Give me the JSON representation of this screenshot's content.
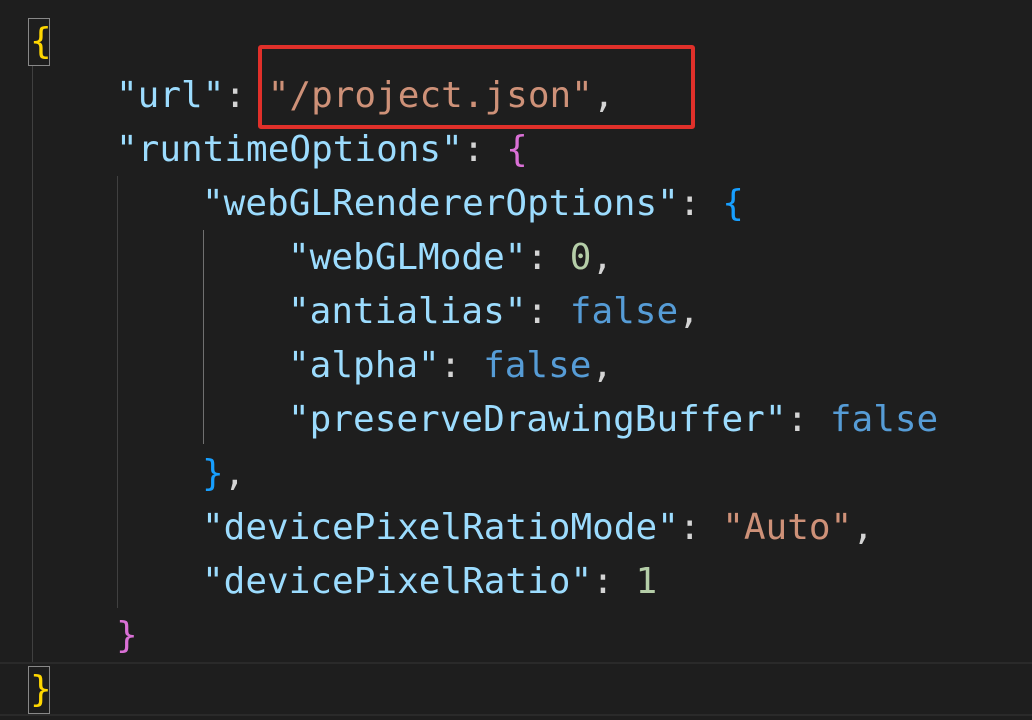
{
  "colors": {
    "background": "#1e1e1e",
    "string": "#ce9178",
    "key": "#9cdcfe",
    "number": "#b5cea8",
    "keyword": "#569cd6",
    "bracket_level1": "#ffd700",
    "bracket_level2": "#da70d6",
    "bracket_level3": "#179fff",
    "annotation_box": "#e0302a"
  },
  "code": {
    "open_root": "{",
    "url_key": "\"url\"",
    "url_value": "\"/project.json\"",
    "runtime_key": "\"runtimeOptions\"",
    "runtime_open": "{",
    "webgl_key": "\"webGLRendererOptions\"",
    "webgl_open": "{",
    "webglmode_key": "\"webGLMode\"",
    "webglmode_value": "0",
    "antialias_key": "\"antialias\"",
    "antialias_value": "false",
    "alpha_key": "\"alpha\"",
    "alpha_value": "false",
    "preserve_key": "\"preserveDrawingBuffer\"",
    "preserve_value": "false",
    "webgl_close": "}",
    "dprmode_key": "\"devicePixelRatioMode\"",
    "dprmode_value": "\"Auto\"",
    "dpr_key": "\"devicePixelRatio\"",
    "dpr_value": "1",
    "runtime_close": "}",
    "close_root": "}",
    "colon": ": ",
    "comma": ","
  }
}
